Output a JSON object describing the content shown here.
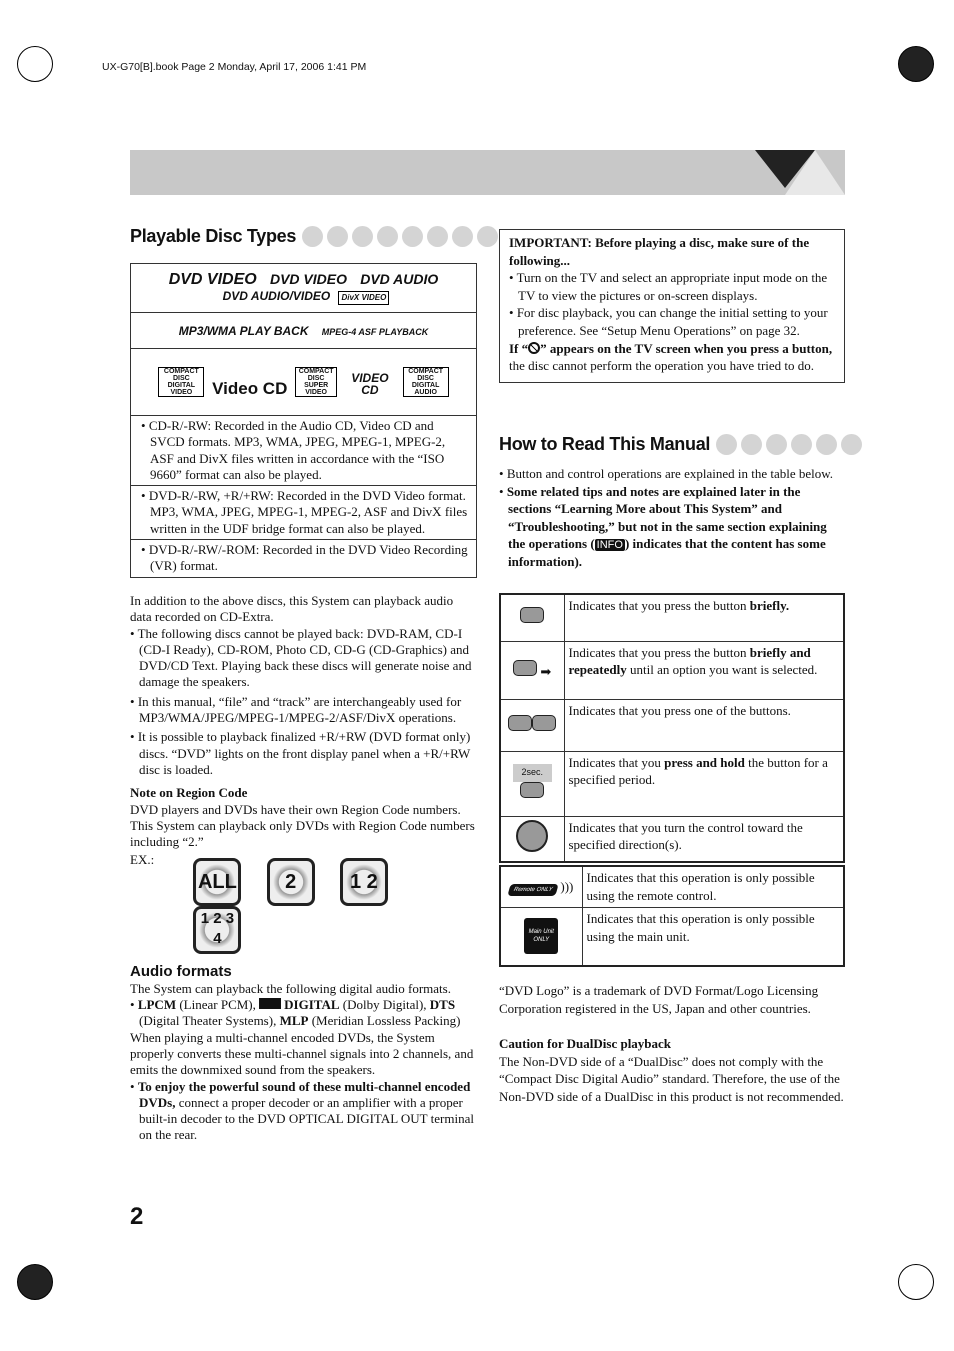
{
  "header_info": "UX-G70[B].book Page 2 Monday, April 17, 2006 1:41 PM",
  "left": {
    "title": "Playable Disc Types",
    "logos_row1": [
      "DVD VIDEO",
      "DVD VIDEO",
      "DVD AUDIO",
      "DVD AUDIO/VIDEO",
      "DivX VIDEO"
    ],
    "logos_row2": [
      "MP3/WMA PLAY BACK",
      "MPEG-4 ASF PLAYBACK"
    ],
    "logos_row3": [
      "COMPACT DISC DIGITAL VIDEO",
      "Video CD",
      "COMPACT DISC SUPER VIDEO",
      "VIDEO CD",
      "COMPACT DISC DIGITAL AUDIO"
    ],
    "disc_notes": [
      "CD-R/-RW: Recorded in the Audio CD, Video CD and SVCD formats. MP3, WMA, JPEG, MPEG-1, MPEG-2, ASF and DivX files written in accordance with the “ISO 9660” format can also be played.",
      "DVD-R/-RW, +R/+RW: Recorded in the DVD Video format. MP3, WMA, JPEG, MPEG-1, MPEG-2, ASF and DivX files written in the UDF bridge format can also be played.",
      "DVD-R/-RW/-ROM: Recorded in the DVD Video Recording (VR) format."
    ],
    "para1": "In addition to the above discs, this System can playback audio data recorded on CD-Extra.",
    "bullets": [
      "The following discs cannot be played back: DVD-RAM, CD-I (CD-I Ready), CD-ROM, Photo CD, CD-G (CD-Graphics) and DVD/CD Text. Playing back these discs will generate noise and damage the speakers.",
      "In this manual, “file” and “track” are interchangeably used for MP3/WMA/JPEG/MPEG-1/MPEG-2/ASF/DivX operations.",
      "It is possible to playback finalized +R/+RW (DVD format only) discs. “DVD” lights on the front display panel when a +R/+RW disc is loaded."
    ],
    "region_title": "Note on Region Code",
    "region_text": "DVD players and DVDs have their own Region Code numbers. This System can playback only DVDs with Region Code numbers including “2.”",
    "ex_label": "EX.:",
    "region_icons": [
      "ALL",
      "2",
      "1 2",
      "1 2 3 4"
    ],
    "audio_title": "Audio formats",
    "audio_intro": "The System can playback the following digital audio formats.",
    "audio_list": {
      "lpcm": "LPCM",
      "lpcm_d": " (Linear PCM), ",
      "dolby": "DIGITAL",
      "dolby_d": " (Dolby Digital), ",
      "dts": "DTS",
      "dts_d": " (Digital Theater Systems), ",
      "mlp": "MLP",
      "mlp_d": " (Meridian Lossless Packing)"
    },
    "multi_text": "When playing a multi-channel encoded DVDs, the System properly converts these multi-channel signals into 2 channels, and emits the downmixed sound from the speakers.",
    "enjoy_bold": "To enjoy the powerful sound of these multi-channel encoded DVDs,",
    "enjoy_rest": " connect a proper decoder or an amplifier with a proper built-in decoder to the DVD OPTICAL DIGITAL OUT terminal on the rear."
  },
  "right": {
    "important_title": "IMPORTANT: Before playing a disc, make sure of the following...",
    "important_items": [
      "Turn on the TV and select an appropriate input mode on the TV to view the pictures or on-screen displays.",
      "For disc playback, you can change the initial setting to your preference. See “Setup Menu Operations” on page 32."
    ],
    "if_bold1": "If “",
    "if_bold2": "” appears on the TV screen when you press a button,",
    "if_rest": " the disc cannot perform the operation you have tried to do.",
    "title": "How to Read This Manual",
    "b1": "Button and control operations are explained in the table below.",
    "b2_bold": "Some related tips and notes are explained later in the sections “Learning More about This System” and “Troubleshooting,” but not in the same section explaining the operations (",
    "info_badge": "INFO",
    "b2_bold2": ") indicates that the content has some information).",
    "ops": [
      {
        "pre": "Indicates that you press the button ",
        "bold": "briefly.",
        "post": ""
      },
      {
        "pre": "Indicates that you press the button ",
        "bold": "briefly and repeatedly",
        "post": " until an option you want is selected."
      },
      {
        "pre": "Indicates that you press one of the buttons.",
        "bold": "",
        "post": ""
      },
      {
        "pre": "Indicates that you ",
        "bold": "press and hold",
        "post": " the button for a specified period."
      },
      {
        "pre": "Indicates that you turn the control toward the specified direction(s).",
        "bold": "",
        "post": ""
      }
    ],
    "hold_label": "2sec.",
    "only": [
      {
        "icon": "Remote ONLY",
        "text": "Indicates that this operation is only possible using the remote control."
      },
      {
        "icon": "Main Unit ONLY",
        "text": "Indicates that this operation is only possible using the main unit."
      }
    ],
    "trademark": "“DVD Logo” is a trademark of DVD Format/Logo Licensing Corporation registered in the US, Japan and other countries.",
    "caution_title": "Caution for DualDisc playback",
    "caution_text": "The Non-DVD side of a “DualDisc” does not comply with the “Compact Disc Digital Audio” standard. Therefore, the use of the Non-DVD side of a DualDisc in this product is not recommended."
  },
  "page_number": "2"
}
